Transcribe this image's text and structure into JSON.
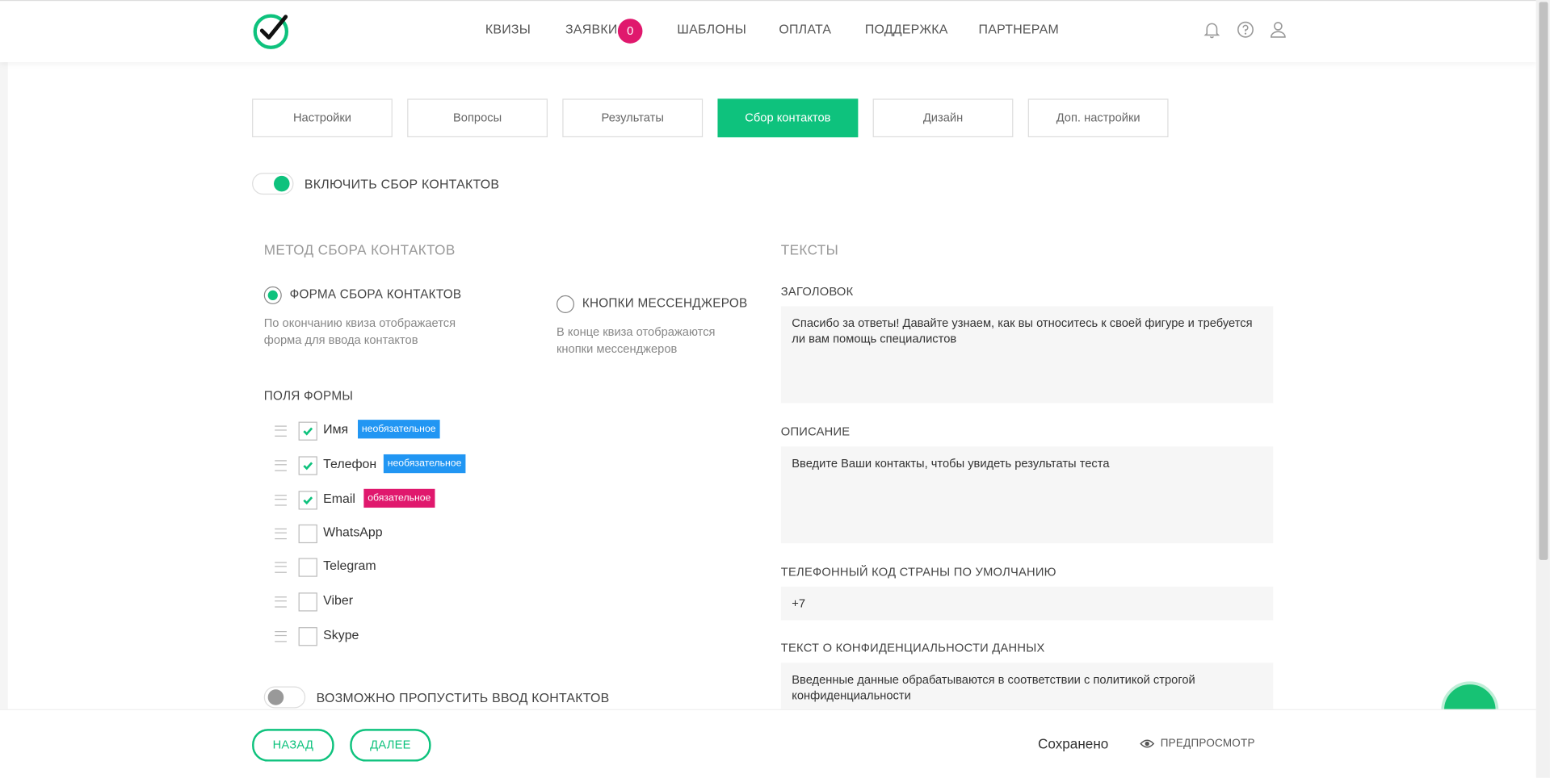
{
  "nav": {
    "items": [
      "КВИЗЫ",
      "ЗАЯВКИ",
      "ШАБЛОНЫ",
      "ОПЛАТА",
      "ПОДДЕРЖКА",
      "ПАРТНЕРАМ"
    ],
    "requests_badge": "0"
  },
  "tabs": [
    "Настройки",
    "Вопросы",
    "Результаты",
    "Сбор контактов",
    "Дизайн",
    "Доп. настройки"
  ],
  "contacts": {
    "enable_label": "ВКЛЮЧИТЬ СБОР КОНТАКТОВ",
    "enable_on": true,
    "method_title": "МЕТОД СБОРА КОНТАКТОВ",
    "form_option": "ФОРМА СБОРА КОНТАКТОВ",
    "form_desc": "По окончанию квиза отображается форма для ввода контактов",
    "messenger_option": "КНОПКИ МЕССЕНДЖЕРОВ",
    "messenger_desc": "В конце квиза отображаются кнопки мессенджеров",
    "fields_title": "ПОЛЯ ФОРМЫ",
    "fields": [
      {
        "name": "Имя",
        "checked": true,
        "tag": "необязательное",
        "required": false
      },
      {
        "name": "Телефон",
        "checked": true,
        "tag": "необязательное",
        "required": false
      },
      {
        "name": "Email",
        "checked": true,
        "tag": "обязательное",
        "required": true
      },
      {
        "name": "WhatsApp",
        "checked": false,
        "tag": ""
      },
      {
        "name": "Telegram",
        "checked": false,
        "tag": ""
      },
      {
        "name": "Viber",
        "checked": false,
        "tag": ""
      },
      {
        "name": "Skype",
        "checked": false,
        "tag": ""
      }
    ],
    "skip_label": "ВОЗМОЖНО ПРОПУСТИТЬ ВВОД КОНТАКТОВ",
    "skip_on": false
  },
  "texts": {
    "title": "ТЕКСТЫ",
    "heading_label": "ЗАГОЛОВОК",
    "heading_value": "Спасибо за ответы! Давайте узнаем, как вы относитесь к своей фигуре и требуется ли вам помощь специалистов",
    "description_label": "ОПИСАНИЕ",
    "description_value": "Введите Ваши контакты, чтобы увидеть результаты теста",
    "phone_code_label": "ТЕЛЕФОННЫЙ КОД СТРАНЫ ПО УМОЛЧАНИЮ",
    "phone_code_value": "+7",
    "privacy_label": "ТЕКСТ О КОНФИДЕНЦИАЛЬНОСТИ ДАННЫХ",
    "privacy_value": "Введенные данные обрабатываются в соответствии с политикой строгой конфиденциальности"
  },
  "footer": {
    "back": "НАЗАД",
    "next": "ДАЛЕЕ",
    "saved": "Сохранено",
    "preview": "ПРЕДПРОСМОТР"
  },
  "colors": {
    "accent": "#0ec27d",
    "badge": "#e0186d",
    "optional_tag": "#2196f3",
    "required_tag": "#e0186d"
  }
}
